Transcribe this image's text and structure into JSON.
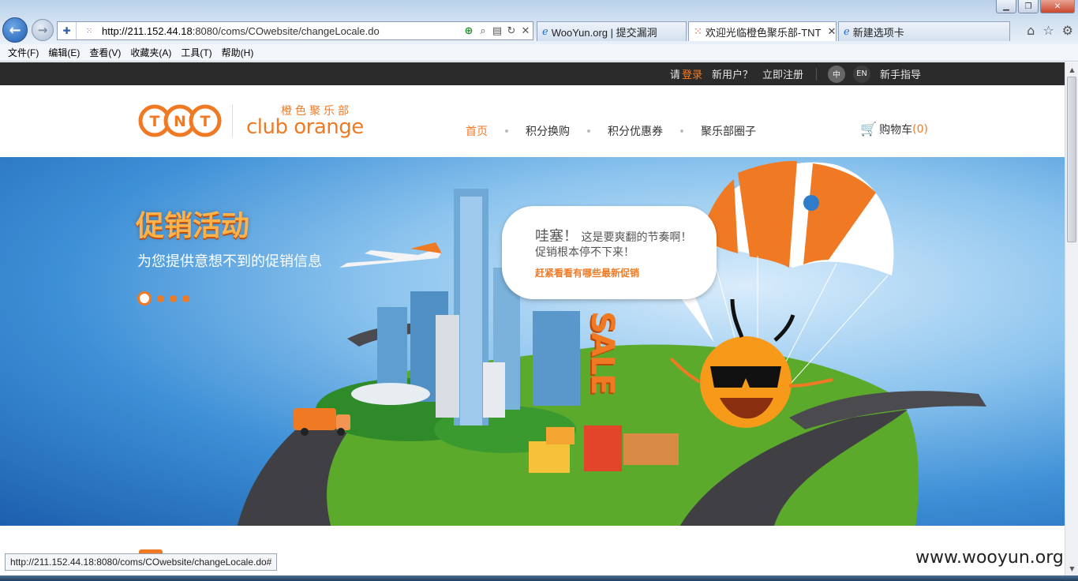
{
  "browser": {
    "address_url_host": "http://211.152.44.18",
    "address_url_rest": ":8080/coms/COwebsite/changeLocale.do",
    "tabs": [
      {
        "label": "WooYun.org | 提交漏洞",
        "icon": "ie-icon"
      },
      {
        "label": "欢迎光临橙色聚乐部-TNT",
        "icon": "loading-icon",
        "active": true
      },
      {
        "label": "新建选项卡",
        "icon": "ie-icon"
      }
    ],
    "menu": [
      "文件(F)",
      "编辑(E)",
      "查看(V)",
      "收藏夹(A)",
      "工具(T)",
      "帮助(H)"
    ],
    "status_url": "http://211.152.44.18:8080/coms/COwebsite/changeLocale.do#"
  },
  "topbar": {
    "login_prefix": "请",
    "login_link": "登录",
    "new_user": "新用户？",
    "register": "立即注册",
    "lang_zh": "中",
    "lang_en": "EN",
    "guide": "新手指导"
  },
  "header": {
    "logo_text": "TNT",
    "club_cn": "橙色聚乐部",
    "club_en": "club orange",
    "nav": [
      {
        "label": "首页",
        "active": true
      },
      {
        "label": "积分换购"
      },
      {
        "label": "积分优惠券"
      },
      {
        "label": "聚乐部圈子"
      }
    ],
    "cart_label": "购物车",
    "cart_count": "(0)"
  },
  "banner": {
    "title": "促销活动",
    "subtitle": "为您提供意想不到的促销信息",
    "bubble_big": "哇塞！",
    "bubble_line1": "这是要爽翻的节奏啊！",
    "bubble_line2": "促销根本停不下来！",
    "bubble_cta": "赶紧看看有哪些最新促销",
    "sale_sign": "SALE",
    "parachute_logo": "TNT",
    "slider": {
      "count": 4,
      "active_index": 0
    }
  },
  "watermark": "www.wooyun.org",
  "colors": {
    "accent": "#f07a24",
    "topbar": "#2b2b2b"
  }
}
